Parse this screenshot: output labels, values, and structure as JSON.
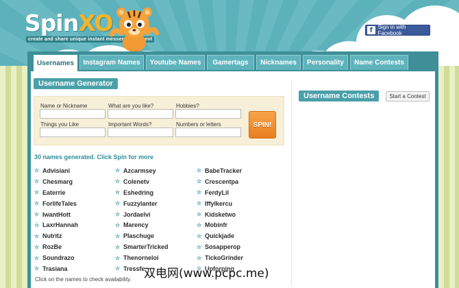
{
  "header": {
    "logo_spin": "Spin",
    "logo_xo": "XO",
    "tagline": "create and share unique instant messenger content",
    "facebook_button": "Sign in with Facebook",
    "facebook_icon": "f"
  },
  "tabs": [
    {
      "label": "Usernames",
      "active": true
    },
    {
      "label": "Instagram Names",
      "active": false
    },
    {
      "label": "Youtube Names",
      "active": false
    },
    {
      "label": "Gamertags",
      "active": false
    },
    {
      "label": "Nicknames",
      "active": false
    },
    {
      "label": "Personality",
      "active": false
    },
    {
      "label": "Name Contests",
      "active": false
    }
  ],
  "generator": {
    "title": "Username Generator",
    "fields": {
      "name_or_nickname": {
        "label": "Name or Nickname",
        "value": ""
      },
      "what_you_like": {
        "label": "What are you like?",
        "value": ""
      },
      "hobbies": {
        "label": "Hobbies?",
        "value": ""
      },
      "things_you_like": {
        "label": "Things you Like",
        "value": ""
      },
      "important_words": {
        "label": "Important Words?",
        "value": ""
      },
      "numbers_or_letters": {
        "label": "Numbers or letters",
        "value": ""
      }
    },
    "spin_label": "SPIN!"
  },
  "results": {
    "summary": "30 names generated. Click Spin for more",
    "columns": [
      [
        "Advisiani",
        "Chesmarg",
        "Eaterrie",
        "ForlifeTales",
        "IwantHott",
        "LaxrHannah",
        "Nutritz",
        "RozBe",
        "Soundrazo",
        "Trasiana"
      ],
      [
        "Azcarmsey",
        "Colenetv",
        "Eshedring",
        "Fuzzylanter",
        "Jordaelvi",
        "Marency",
        "Plaschuge",
        "SmarterTricked",
        "Thenorneloi",
        "Tressfe"
      ],
      [
        "BabeTracker",
        "Crescentpa",
        "FerdyLil",
        "Iffylkercu",
        "Kidsketwo",
        "Mobinfr",
        "Quickjade",
        "Sosapperop",
        "TickoGrinder",
        "Upforping"
      ]
    ],
    "star_icon": "star-icon",
    "note": "Click on the names to check availability."
  },
  "contests": {
    "title": "Username Contests",
    "start_button": "Start a Contest"
  },
  "watermark": "双电网(www.pcpc.me)",
  "colors": {
    "teal": "#3e8f98",
    "accent_teal": "#4aa0a9",
    "spin_orange": "#e97f1f",
    "facebook_blue": "#3b5a9a",
    "logo_orange": "#f5b42a"
  }
}
